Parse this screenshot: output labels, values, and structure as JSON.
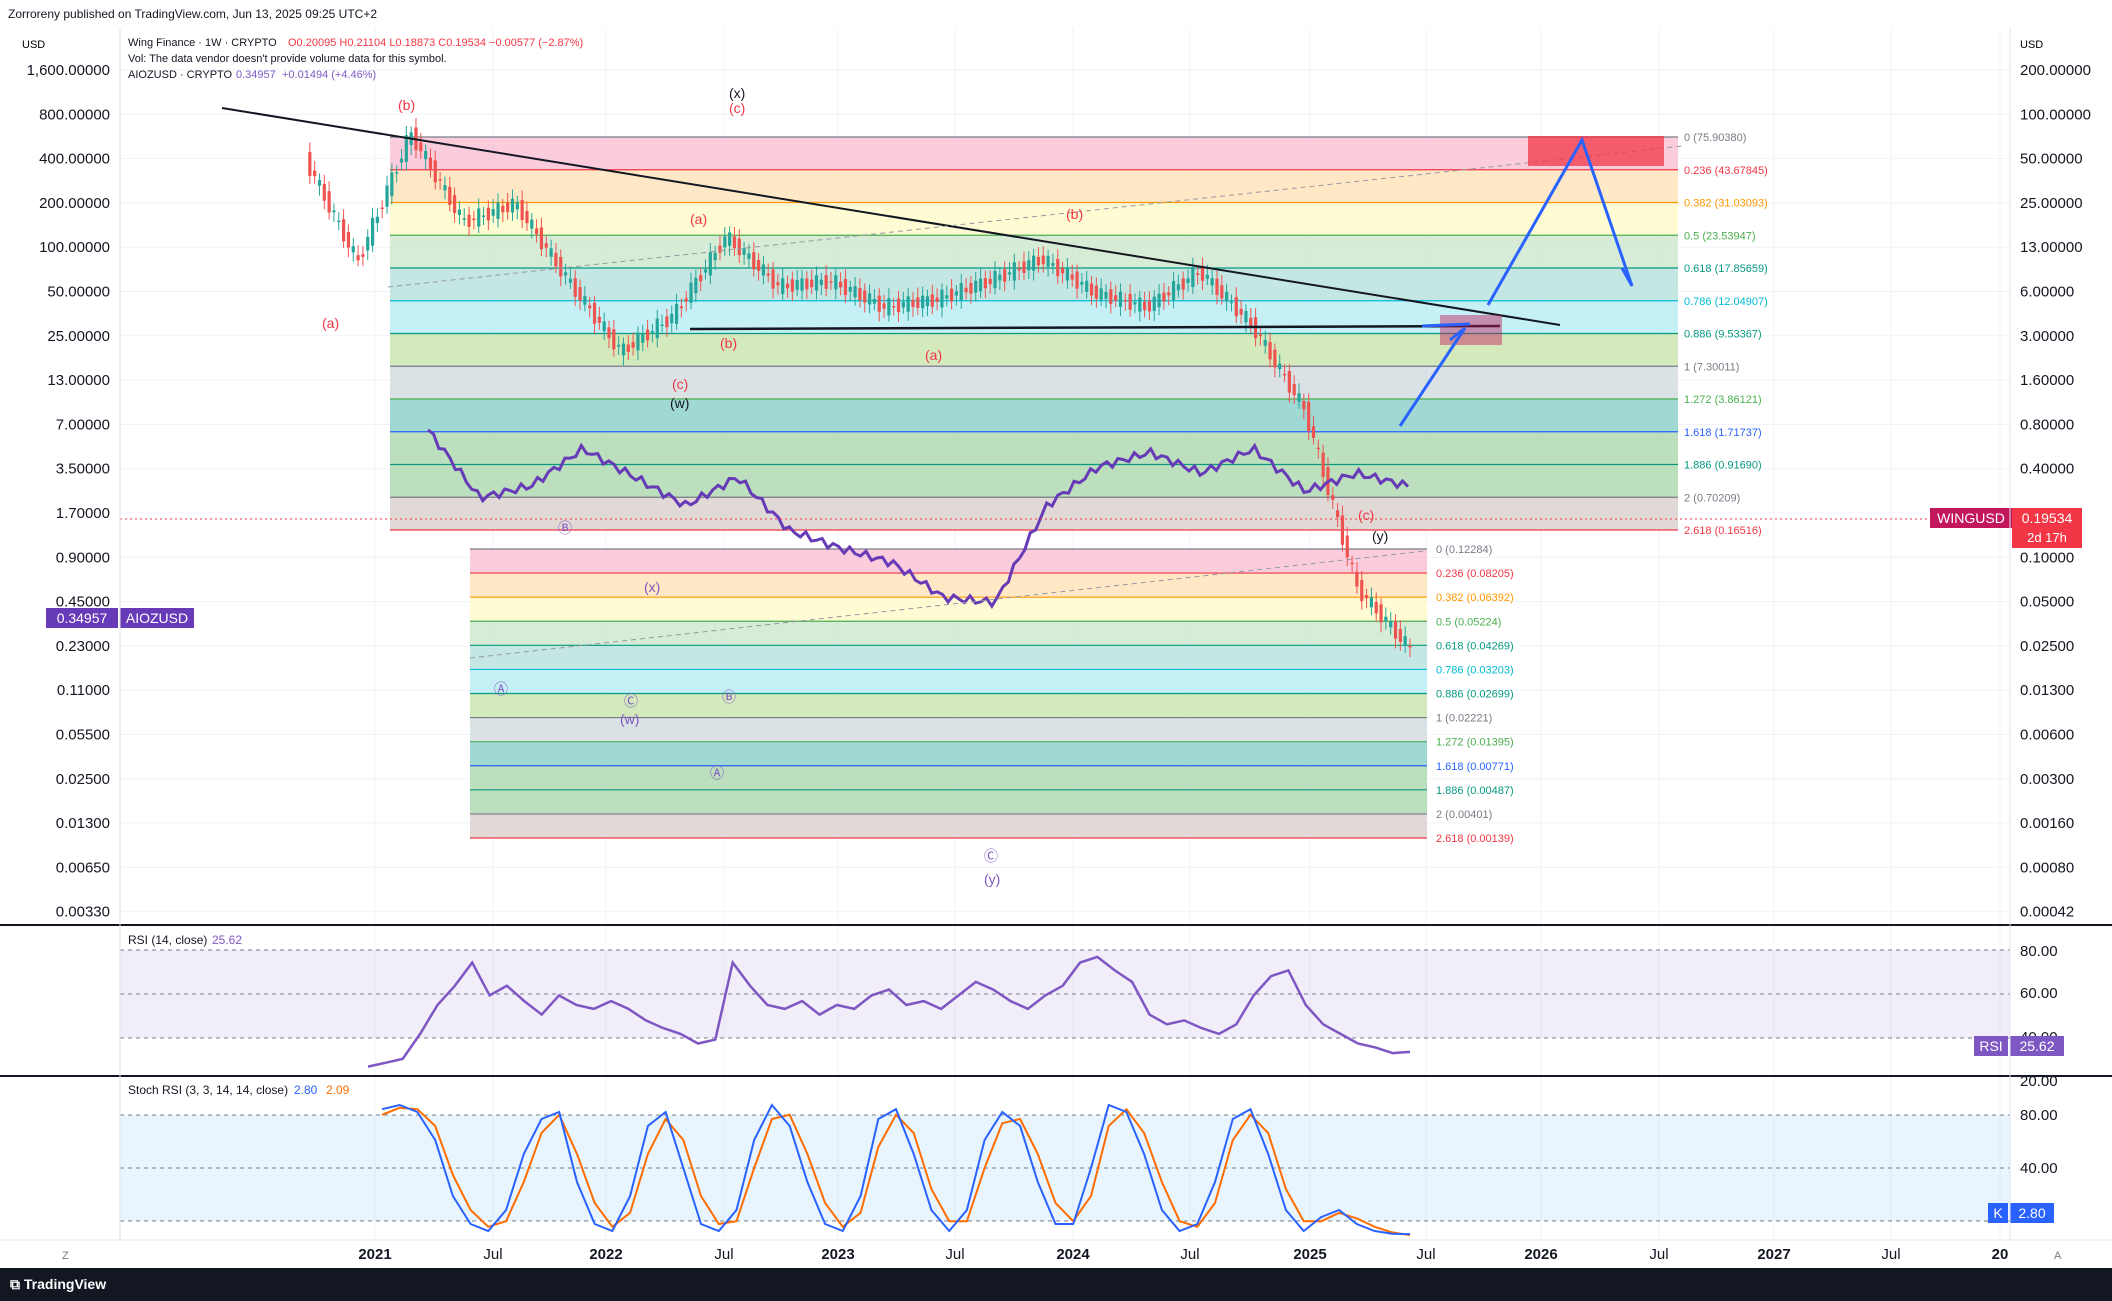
{
  "header": {
    "published": "Zorroreny published on TradingView.com, Jun 13, 2025 09:25 UTC+2",
    "symbol_title": "Wing Finance · 1W · CRYPTO",
    "ohlc": "O0.20095  H0.21104  L0.18873  C0.19534  −0.00577 (−2.87%)",
    "vol_note": "Vol: The data vendor doesn't provide volume data for this symbol.",
    "compare_symbol": "AIOZUSD · CRYPTO",
    "compare_value": "0.34957",
    "compare_change": "+0.01494 (+4.46%)"
  },
  "axes": {
    "left_unit": "USD",
    "right_unit": "USD",
    "left_ticks": [
      "1,600.00000",
      "800.00000",
      "400.00000",
      "200.00000",
      "100.00000",
      "50.00000",
      "25.00000",
      "13.00000",
      "7.00000",
      "3.50000",
      "1.70000",
      "0.90000",
      "0.45000",
      "0.23000",
      "0.11000",
      "0.05500",
      "0.02500",
      "0.01300",
      "0.00650",
      "0.00330"
    ],
    "right_ticks": [
      "200.00000",
      "100.00000",
      "50.00000",
      "25.00000",
      "13.00000",
      "6.00000",
      "3.00000",
      "1.60000",
      "0.80000",
      "0.40000",
      "0.20000",
      "0.10000",
      "0.05000",
      "0.02500",
      "0.01300",
      "0.00600",
      "0.00300",
      "0.00160",
      "0.00080",
      "0.00042"
    ],
    "time_ticks": [
      "2021",
      "Jul",
      "2022",
      "Jul",
      "2023",
      "Jul",
      "2024",
      "Jul",
      "2025",
      "Jul",
      "2026",
      "Jul",
      "2027",
      "Jul",
      "20"
    ],
    "z_label": "Z",
    "a_label": "A"
  },
  "price_labels": {
    "wing_name": "WINGUSD",
    "wing_value": "0.19534",
    "wing_countdown": "2d 17h",
    "aioz_value": "0.34957",
    "aioz_name": "AIOZUSD"
  },
  "chart_data": {
    "type": "candlestick",
    "title": "Wing Finance · 1W · CRYPTO",
    "scale": "log",
    "series": [
      {
        "name": "WINGUSD",
        "type": "candlestick",
        "color_up": "#26a69a",
        "color_down": "#ef5350",
        "x": [
          "2020-11",
          "2021-01",
          "2021-04",
          "2021-07",
          "2021-10",
          "2022-01",
          "2022-04",
          "2022-06",
          "2022-07",
          "2022-10",
          "2023-01",
          "2023-04",
          "2023-07",
          "2023-10",
          "2024-01",
          "2024-04",
          "2024-07",
          "2024-10",
          "2025-01",
          "2025-03",
          "2025-05",
          "2025-06"
        ],
        "close": [
          400,
          80,
          600,
          150,
          200,
          60,
          20,
          35,
          120,
          55,
          60,
          40,
          45,
          60,
          85,
          50,
          40,
          70,
          30,
          8,
          0.5,
          0.19534
        ]
      },
      {
        "name": "AIOZUSD",
        "type": "line",
        "color": "#7e57c2",
        "x": [
          "2021-03",
          "2021-05",
          "2021-07",
          "2021-10",
          "2021-12",
          "2022-02",
          "2022-04",
          "2022-06",
          "2022-09",
          "2023-01",
          "2023-05",
          "2023-09",
          "2023-11",
          "2024-01",
          "2024-03",
          "2024-07",
          "2024-11",
          "2025-01",
          "2025-03",
          "2025-06"
        ],
        "values": [
          1.7,
          0.25,
          0.35,
          1.0,
          0.45,
          0.2,
          0.45,
          0.1,
          0.06,
          0.04,
          0.015,
          0.013,
          0.2,
          0.6,
          0.9,
          0.5,
          1.0,
          0.3,
          0.5,
          0.34957
        ]
      }
    ],
    "fib_wing": [
      {
        "label": "0 (75.90380)",
        "color": "#787b86"
      },
      {
        "label": "0.236 (43.67845)",
        "color": "#f23645"
      },
      {
        "label": "0.382 (31.03093)",
        "color": "#ff9800"
      },
      {
        "label": "0.5 (23.53947)",
        "color": "#4caf50"
      },
      {
        "label": "0.618 (17.85659)",
        "color": "#089981"
      },
      {
        "label": "0.786 (12.04907)",
        "color": "#00bcd4"
      },
      {
        "label": "0.886 (9.53367)",
        "color": "#089981"
      },
      {
        "label": "1 (7.30011)",
        "color": "#787b86"
      },
      {
        "label": "1.272 (3.86121)",
        "color": "#4caf50"
      },
      {
        "label": "1.618 (1.71737)",
        "color": "#2962ff"
      },
      {
        "label": "1.886 (0.91690)",
        "color": "#089981"
      },
      {
        "label": "2 (0.70209)",
        "color": "#787b86"
      },
      {
        "label": "2.618 (0.16516)",
        "color": "#f23645"
      }
    ],
    "fib_aioz": [
      {
        "label": "0 (0.12284)",
        "color": "#787b86"
      },
      {
        "label": "0.236 (0.08205)",
        "color": "#f23645"
      },
      {
        "label": "0.382 (0.06392)",
        "color": "#ff9800"
      },
      {
        "label": "0.5 (0.05224)",
        "color": "#4caf50"
      },
      {
        "label": "0.618 (0.04269)",
        "color": "#089981"
      },
      {
        "label": "0.786 (0.03203)",
        "color": "#00bcd4"
      },
      {
        "label": "0.886 (0.02699)",
        "color": "#089981"
      },
      {
        "label": "1 (0.02221)",
        "color": "#787b86"
      },
      {
        "label": "1.272 (0.01395)",
        "color": "#4caf50"
      },
      {
        "label": "1.618 (0.00771)",
        "color": "#2962ff"
      },
      {
        "label": "1.886 (0.00487)",
        "color": "#089981"
      },
      {
        "label": "2 (0.00401)",
        "color": "#787b86"
      },
      {
        "label": "2.618 (0.00139)",
        "color": "#f23645"
      }
    ],
    "wave_labels_red": [
      "(b)",
      "(c)",
      "(a)",
      "(b)",
      "(a)",
      "(b)",
      "(c)",
      "(a)",
      "(c)"
    ],
    "wave_labels_black": [
      "(x)",
      "(w)",
      "(y)"
    ],
    "wave_labels_purple": [
      "Ⓑ",
      "(x)",
      "Ⓐ",
      "Ⓒ",
      "(w)",
      "Ⓑ",
      "Ⓐ",
      "Ⓒ",
      "(y)"
    ]
  },
  "rsi": {
    "title": "RSI (14, close)",
    "value": "25.62",
    "badge_name": "RSI",
    "ticks": [
      "80.00",
      "60.00",
      "40.00",
      "20.00"
    ],
    "values": [
      18,
      20,
      22,
      35,
      50,
      60,
      72,
      55,
      60,
      52,
      45,
      55,
      50,
      48,
      52,
      48,
      42,
      38,
      35,
      30,
      32,
      72,
      60,
      50,
      48,
      52,
      45,
      50,
      48,
      55,
      58,
      50,
      52,
      48,
      55,
      62,
      58,
      52,
      48,
      55,
      60,
      72,
      75,
      68,
      62,
      45,
      40,
      42,
      38,
      35,
      40,
      55,
      65,
      68,
      50,
      40,
      35,
      30,
      28,
      25,
      25.62
    ]
  },
  "stoch": {
    "title": "Stoch RSI (3, 3, 14, 14, close)",
    "k_value": "2.80",
    "d_value": "2.09",
    "badge_name": "K",
    "ticks": [
      "80.00",
      "40.00"
    ],
    "k": [
      92,
      95,
      90,
      70,
      30,
      10,
      5,
      20,
      60,
      85,
      90,
      40,
      10,
      5,
      30,
      80,
      90,
      50,
      10,
      5,
      20,
      70,
      95,
      80,
      40,
      10,
      5,
      30,
      85,
      92,
      60,
      20,
      5,
      20,
      70,
      90,
      80,
      40,
      10,
      10,
      50,
      95,
      90,
      60,
      20,
      5,
      10,
      40,
      85,
      92,
      60,
      20,
      5,
      15,
      20,
      10,
      5,
      3,
      2.8
    ],
    "d": [
      88,
      93,
      92,
      80,
      45,
      20,
      8,
      12,
      40,
      75,
      88,
      60,
      25,
      8,
      18,
      60,
      85,
      70,
      30,
      10,
      12,
      50,
      85,
      88,
      60,
      25,
      8,
      18,
      65,
      88,
      75,
      35,
      12,
      12,
      50,
      82,
      85,
      60,
      25,
      12,
      30,
      80,
      92,
      75,
      40,
      12,
      8,
      25,
      70,
      88,
      75,
      35,
      12,
      12,
      18,
      14,
      8,
      4,
      2.09
    ]
  }
}
